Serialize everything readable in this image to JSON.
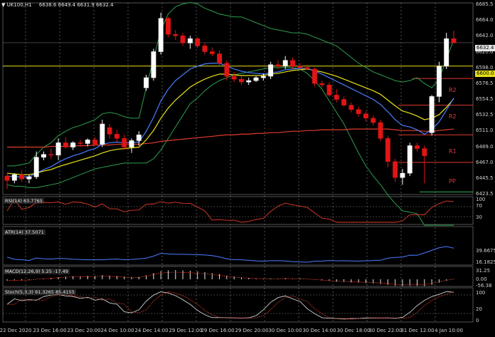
{
  "header": {
    "symbol_label": "UK100,H1",
    "ohlc": "6638.6 6649.4 6631.9 6632.4",
    "menu_icon": "triangle-down-icon"
  },
  "colors": {
    "up": "#ffffff",
    "down": "#e01515",
    "bb": "#2e9e4f",
    "ema_fast": "#4a7dff",
    "ema_slow": "#e8e21a",
    "ema_long": "#e03b2b",
    "last": "#e6e6e6"
  },
  "y_axis_labels": [
    "6685.5",
    "6664.0",
    "6642.0",
    "6620.0",
    "6598.0",
    "6576.5",
    "6554.5",
    "6532.5",
    "6511.0",
    "6489.0",
    "6467.0",
    "6445.5",
    "6423.5"
  ],
  "price_tags": {
    "last": "6632.4",
    "level": "6600.0"
  },
  "pivot_labels": [
    "R2",
    "R2",
    "R1",
    "PP"
  ],
  "x_axis_labels": [
    "22 Dec 2020",
    "23 Dec 16:00",
    "23 Dec 20:00",
    "24 Dec 10:00",
    "24 Dec 14:00",
    "29 Dec 12:00",
    "29 Dec 16:00",
    "29 Dec 20:00",
    "30 Dec 10:00",
    "30 Dec 14:00",
    "30 Dec 18:00",
    "30 Dec 22:00",
    "31 Dec 12:00",
    "4 Jan 10:00"
  ],
  "rsi": {
    "legend": "RSI(14) 63.7765",
    "levels": [
      "70",
      "30"
    ],
    "scale_top": "100"
  },
  "atr": {
    "legend": "ATR(14) 37.5071",
    "labels": [
      "39.6675",
      "16.1825"
    ]
  },
  "macd": {
    "legend": "MACD(12,26,9) 5.25 -17.49",
    "labels": [
      "31.25",
      "0.00",
      "-56.38"
    ]
  },
  "stoch": {
    "legend": "Stoch(5,3,3) 91.3265 85.4155",
    "labels": [
      "100",
      "20",
      "0"
    ]
  },
  "chart_data": {
    "type": "candlestick",
    "ylim": [
      6423.5,
      6685.5
    ],
    "candles": [
      {
        "o": 6448,
        "h": 6452,
        "l": 6430,
        "c": 6442
      },
      {
        "o": 6442,
        "h": 6452,
        "l": 6438,
        "c": 6450
      },
      {
        "o": 6450,
        "h": 6456,
        "l": 6440,
        "c": 6444
      },
      {
        "o": 6444,
        "h": 6450,
        "l": 6438,
        "c": 6447
      },
      {
        "o": 6447,
        "h": 6482,
        "l": 6444,
        "c": 6474
      },
      {
        "o": 6474,
        "h": 6482,
        "l": 6470,
        "c": 6478
      },
      {
        "o": 6478,
        "h": 6486,
        "l": 6472,
        "c": 6477
      },
      {
        "o": 6477,
        "h": 6500,
        "l": 6470,
        "c": 6494
      },
      {
        "o": 6494,
        "h": 6502,
        "l": 6486,
        "c": 6488
      },
      {
        "o": 6488,
        "h": 6496,
        "l": 6484,
        "c": 6494
      },
      {
        "o": 6494,
        "h": 6498,
        "l": 6488,
        "c": 6493
      },
      {
        "o": 6493,
        "h": 6500,
        "l": 6489,
        "c": 6498
      },
      {
        "o": 6498,
        "h": 6502,
        "l": 6490,
        "c": 6492
      },
      {
        "o": 6492,
        "h": 6526,
        "l": 6488,
        "c": 6520
      },
      {
        "o": 6515,
        "h": 6520,
        "l": 6500,
        "c": 6506
      },
      {
        "o": 6506,
        "h": 6512,
        "l": 6495,
        "c": 6500
      },
      {
        "o": 6500,
        "h": 6505,
        "l": 6484,
        "c": 6488
      },
      {
        "o": 6488,
        "h": 6500,
        "l": 6480,
        "c": 6497
      },
      {
        "o": 6497,
        "h": 6510,
        "l": 6490,
        "c": 6505
      },
      {
        "o": 6570,
        "h": 6588,
        "l": 6566,
        "c": 6584
      },
      {
        "o": 6584,
        "h": 6624,
        "l": 6580,
        "c": 6620
      },
      {
        "o": 6620,
        "h": 6674,
        "l": 6616,
        "c": 6666
      },
      {
        "o": 6666,
        "h": 6668,
        "l": 6640,
        "c": 6644
      },
      {
        "o": 6644,
        "h": 6650,
        "l": 6636,
        "c": 6642
      },
      {
        "o": 6642,
        "h": 6646,
        "l": 6628,
        "c": 6632
      },
      {
        "o": 6632,
        "h": 6642,
        "l": 6624,
        "c": 6638
      },
      {
        "o": 6638,
        "h": 6640,
        "l": 6625,
        "c": 6628
      },
      {
        "o": 6628,
        "h": 6632,
        "l": 6616,
        "c": 6620
      },
      {
        "o": 6620,
        "h": 6626,
        "l": 6614,
        "c": 6617
      },
      {
        "o": 6617,
        "h": 6622,
        "l": 6600,
        "c": 6604
      },
      {
        "o": 6604,
        "h": 6608,
        "l": 6580,
        "c": 6586
      },
      {
        "o": 6586,
        "h": 6592,
        "l": 6578,
        "c": 6582
      },
      {
        "o": 6582,
        "h": 6586,
        "l": 6574,
        "c": 6578
      },
      {
        "o": 6578,
        "h": 6584,
        "l": 6574,
        "c": 6580
      },
      {
        "o": 6580,
        "h": 6586,
        "l": 6578,
        "c": 6584
      },
      {
        "o": 6584,
        "h": 6590,
        "l": 6580,
        "c": 6586
      },
      {
        "o": 6586,
        "h": 6606,
        "l": 6582,
        "c": 6602
      },
      {
        "o": 6602,
        "h": 6608,
        "l": 6596,
        "c": 6600
      },
      {
        "o": 6600,
        "h": 6614,
        "l": 6596,
        "c": 6608
      },
      {
        "o": 6608,
        "h": 6612,
        "l": 6596,
        "c": 6600
      },
      {
        "o": 6600,
        "h": 6604,
        "l": 6594,
        "c": 6598
      },
      {
        "o": 6598,
        "h": 6602,
        "l": 6594,
        "c": 6596
      },
      {
        "o": 6596,
        "h": 6598,
        "l": 6572,
        "c": 6576
      },
      {
        "o": 6576,
        "h": 6580,
        "l": 6570,
        "c": 6574
      },
      {
        "o": 6574,
        "h": 6578,
        "l": 6558,
        "c": 6560
      },
      {
        "o": 6560,
        "h": 6568,
        "l": 6550,
        "c": 6554
      },
      {
        "o": 6554,
        "h": 6558,
        "l": 6544,
        "c": 6546
      },
      {
        "o": 6546,
        "h": 6550,
        "l": 6536,
        "c": 6540
      },
      {
        "o": 6540,
        "h": 6544,
        "l": 6530,
        "c": 6534
      },
      {
        "o": 6534,
        "h": 6538,
        "l": 6524,
        "c": 6528
      },
      {
        "o": 6528,
        "h": 6532,
        "l": 6518,
        "c": 6522
      },
      {
        "o": 6522,
        "h": 6526,
        "l": 6496,
        "c": 6500
      },
      {
        "o": 6500,
        "h": 6504,
        "l": 6460,
        "c": 6468
      },
      {
        "o": 6468,
        "h": 6472,
        "l": 6440,
        "c": 6446
      },
      {
        "o": 6446,
        "h": 6458,
        "l": 6436,
        "c": 6452
      },
      {
        "o": 6452,
        "h": 6494,
        "l": 6448,
        "c": 6490
      },
      {
        "o": 6490,
        "h": 6494,
        "l": 6482,
        "c": 6486
      },
      {
        "o": 6486,
        "h": 6490,
        "l": 6438,
        "c": 6476
      },
      {
        "o": 6508,
        "h": 6560,
        "l": 6504,
        "c": 6558
      },
      {
        "o": 6558,
        "h": 6606,
        "l": 6550,
        "c": 6600
      },
      {
        "o": 6600,
        "h": 6646,
        "l": 6596,
        "c": 6638
      },
      {
        "o": 6638,
        "h": 6649,
        "l": 6632,
        "c": 6632
      }
    ],
    "ema_fast": [
      6448,
      6447,
      6447,
      6447,
      6452,
      6457,
      6461,
      6467,
      6472,
      6476,
      6479,
      6483,
      6486,
      6492,
      6494,
      6495,
      6494,
      6494,
      6495,
      6510,
      6529,
      6552,
      6568,
      6580,
      6588,
      6596,
      6600,
      6603,
      6604,
      6604,
      6600,
      6596,
      6593,
      6591,
      6590,
      6589,
      6591,
      6592,
      6595,
      6596,
      6597,
      6597,
      6593,
      6589,
      6584,
      6579,
      6574,
      6569,
      6564,
      6559,
      6554,
      6547,
      6537,
      6526,
      6518,
      6516,
      6512,
      6506,
      6512,
      6523,
      6539,
      6556
    ],
    "ema_slow": [
      6452,
      6451,
      6450,
      6450,
      6452,
      6455,
      6457,
      6461,
      6464,
      6467,
      6470,
      6473,
      6476,
      6480,
      6483,
      6485,
      6486,
      6487,
      6488,
      6498,
      6511,
      6528,
      6542,
      6553,
      6562,
      6571,
      6577,
      6582,
      6586,
      6589,
      6589,
      6588,
      6587,
      6587,
      6587,
      6587,
      6589,
      6590,
      6592,
      6594,
      6595,
      6596,
      6594,
      6592,
      6589,
      6586,
      6582,
      6578,
      6574,
      6570,
      6566,
      6561,
      6553,
      6545,
      6538,
      6535,
      6531,
      6526,
      6528,
      6533,
      6543,
      6555
    ],
    "ema_long": [
      6488,
      6488,
      6488,
      6488,
      6488,
      6488,
      6489,
      6489,
      6489,
      6490,
      6490,
      6490,
      6491,
      6491,
      6491,
      6492,
      6492,
      6492,
      6492,
      6493,
      6494,
      6496,
      6497,
      6498,
      6499,
      6500,
      6501,
      6502,
      6503,
      6504,
      6505,
      6505,
      6506,
      6506,
      6507,
      6507,
      6508,
      6508,
      6509,
      6510,
      6510,
      6511,
      6511,
      6512,
      6512,
      6512,
      6512,
      6513,
      6513,
      6513,
      6513,
      6513,
      6513,
      6512,
      6511,
      6511,
      6511,
      6510,
      6510,
      6511,
      6512,
      6513
    ],
    "bb_upper": [
      6462,
      6462,
      6464,
      6466,
      6478,
      6488,
      6494,
      6504,
      6510,
      6515,
      6518,
      6522,
      6526,
      6534,
      6536,
      6534,
      6530,
      6528,
      6528,
      6570,
      6610,
      6650,
      6672,
      6682,
      6686,
      6688,
      6686,
      6680,
      6676,
      6672,
      6670,
      6668,
      6668,
      6664,
      6660,
      6656,
      6652,
      6650,
      6648,
      6646,
      6646,
      6644,
      6640,
      6636,
      6632,
      6628,
      6620,
      6612,
      6604,
      6598,
      6592,
      6588,
      6584,
      6580,
      6578,
      6580,
      6584,
      6576,
      6570,
      6582,
      6610,
      6636
    ],
    "bb_lower": [
      6436,
      6434,
      6434,
      6432,
      6432,
      6434,
      6436,
      6438,
      6442,
      6446,
      6450,
      6454,
      6458,
      6460,
      6462,
      6464,
      6466,
      6466,
      6466,
      6466,
      6472,
      6484,
      6500,
      6516,
      6532,
      6548,
      6556,
      6566,
      6574,
      6580,
      6584,
      6588,
      6590,
      6592,
      6594,
      6596,
      6598,
      6598,
      6598,
      6598,
      6596,
      6590,
      6580,
      6568,
      6552,
      6536,
      6520,
      6500,
      6480,
      6462,
      6448,
      6436,
      6422,
      6410,
      6400,
      6398,
      6396,
      6380,
      6380,
      6380,
      6380,
      6380
    ],
    "horizontal_levels": [
      {
        "label": "level",
        "value": 6600,
        "color": "#e8e21a"
      },
      {
        "label": "R2",
        "value": 6583,
        "color": "#e03b2b"
      },
      {
        "label": "R2",
        "value": 6546,
        "color": "#e03b2b"
      },
      {
        "label": "R1",
        "value": 6505,
        "color": "#e03b2b"
      },
      {
        "label": "PP",
        "value": 6467,
        "color": "#e03b2b"
      }
    ]
  }
}
